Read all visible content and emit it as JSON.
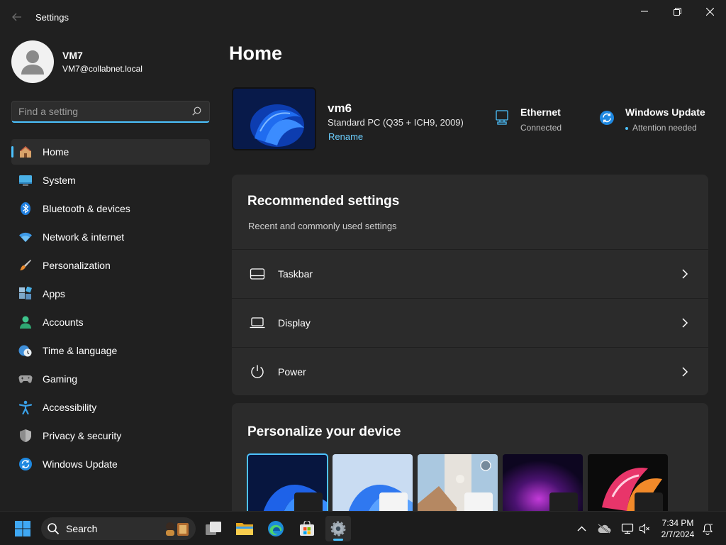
{
  "window": {
    "title": "Settings"
  },
  "user": {
    "name": "VM7",
    "email": "VM7@collabnet.local"
  },
  "search": {
    "placeholder": "Find a setting"
  },
  "sidebar": {
    "items": [
      {
        "label": "Home",
        "icon": "home-icon",
        "active": true
      },
      {
        "label": "System",
        "icon": "system-icon"
      },
      {
        "label": "Bluetooth & devices",
        "icon": "bluetooth-icon"
      },
      {
        "label": "Network & internet",
        "icon": "wifi-icon"
      },
      {
        "label": "Personalization",
        "icon": "brush-icon"
      },
      {
        "label": "Apps",
        "icon": "apps-icon"
      },
      {
        "label": "Accounts",
        "icon": "accounts-icon"
      },
      {
        "label": "Time & language",
        "icon": "clock-globe-icon"
      },
      {
        "label": "Gaming",
        "icon": "gamepad-icon"
      },
      {
        "label": "Accessibility",
        "icon": "accessibility-icon"
      },
      {
        "label": "Privacy & security",
        "icon": "shield-icon"
      },
      {
        "label": "Windows Update",
        "icon": "update-icon"
      }
    ]
  },
  "main": {
    "title": "Home",
    "device": {
      "name": "vm6",
      "model": "Standard PC (Q35 + ICH9, 2009)",
      "rename_label": "Rename"
    },
    "status": {
      "ethernet": {
        "title": "Ethernet",
        "subtitle": "Connected"
      },
      "update": {
        "title": "Windows Update",
        "subtitle": "Attention needed"
      }
    },
    "recommended": {
      "title": "Recommended settings",
      "subtitle": "Recent and commonly used settings",
      "items": [
        {
          "label": "Taskbar",
          "icon": "taskbar-icon"
        },
        {
          "label": "Display",
          "icon": "laptop-icon"
        },
        {
          "label": "Power",
          "icon": "power-icon"
        }
      ]
    },
    "personalize": {
      "title": "Personalize your device",
      "themes": [
        {
          "name": "theme-windows-dark",
          "selected": true
        },
        {
          "name": "theme-windows-light"
        },
        {
          "name": "theme-captured-motion"
        },
        {
          "name": "theme-glow"
        },
        {
          "name": "theme-flow"
        }
      ]
    }
  },
  "taskbar": {
    "search_label": "Search",
    "time": "7:34 PM",
    "date": "2/7/2024"
  },
  "colors": {
    "accent": "#4cc2ff",
    "background": "#202020",
    "card": "#2b2b2b",
    "link": "#6ccfff"
  }
}
